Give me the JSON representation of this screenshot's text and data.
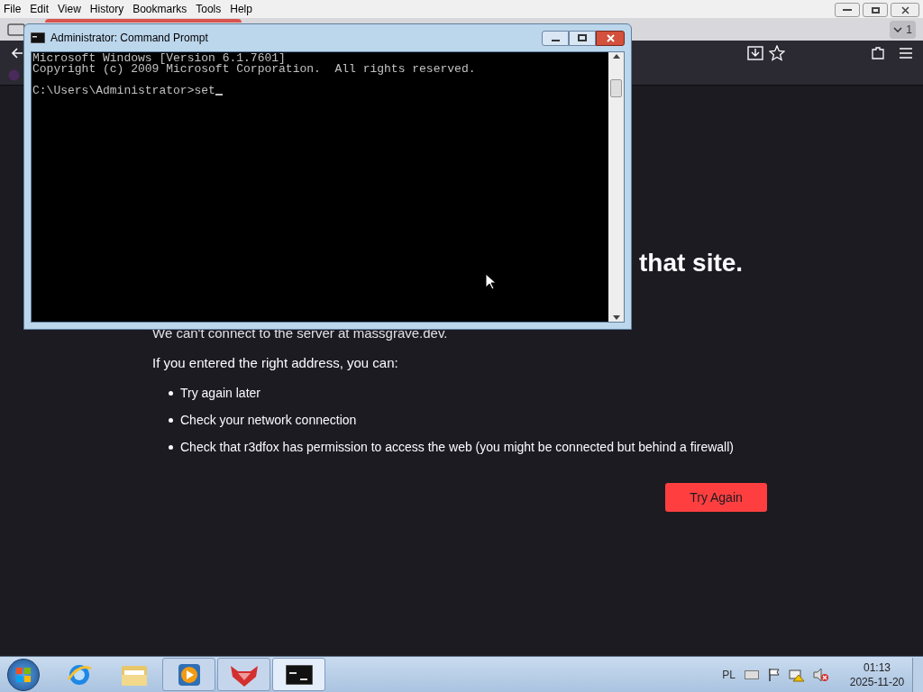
{
  "browser": {
    "menu": [
      {
        "label": "File"
      },
      {
        "label": "Edit"
      },
      {
        "label": "View"
      },
      {
        "label": "History"
      },
      {
        "label": "Bookmarks"
      },
      {
        "label": "Tools"
      },
      {
        "label": "Help"
      }
    ],
    "tab_count": "1",
    "page": {
      "heading": "that site.",
      "message": "We can't connect to the server at massgrave.dev.",
      "hint": "If you entered the right address, you can:",
      "suggestions": [
        "Try again later",
        "Check your network connection",
        "Check that r3dfox has permission to access the web (you might be connected but behind a firewall)"
      ],
      "button": "Try Again"
    }
  },
  "cmd_window": {
    "title": "Administrator: Command Prompt",
    "output": [
      "Microsoft Windows [Version 6.1.7601]",
      "Copyright (c) 2009 Microsoft Corporation.  All rights reserved."
    ],
    "prompt": "C:\\Users\\Administrator>set"
  },
  "taskbar": {
    "apps": [
      {
        "kind": "ie",
        "running": false,
        "selected": false
      },
      {
        "kind": "explorer",
        "running": false,
        "selected": false
      },
      {
        "kind": "media",
        "running": true,
        "selected": false
      },
      {
        "kind": "fox",
        "running": true,
        "selected": false
      },
      {
        "kind": "cmd",
        "running": true,
        "selected": true
      }
    ],
    "language": "PL",
    "time": "01:13",
    "date": "2025-11-20"
  }
}
